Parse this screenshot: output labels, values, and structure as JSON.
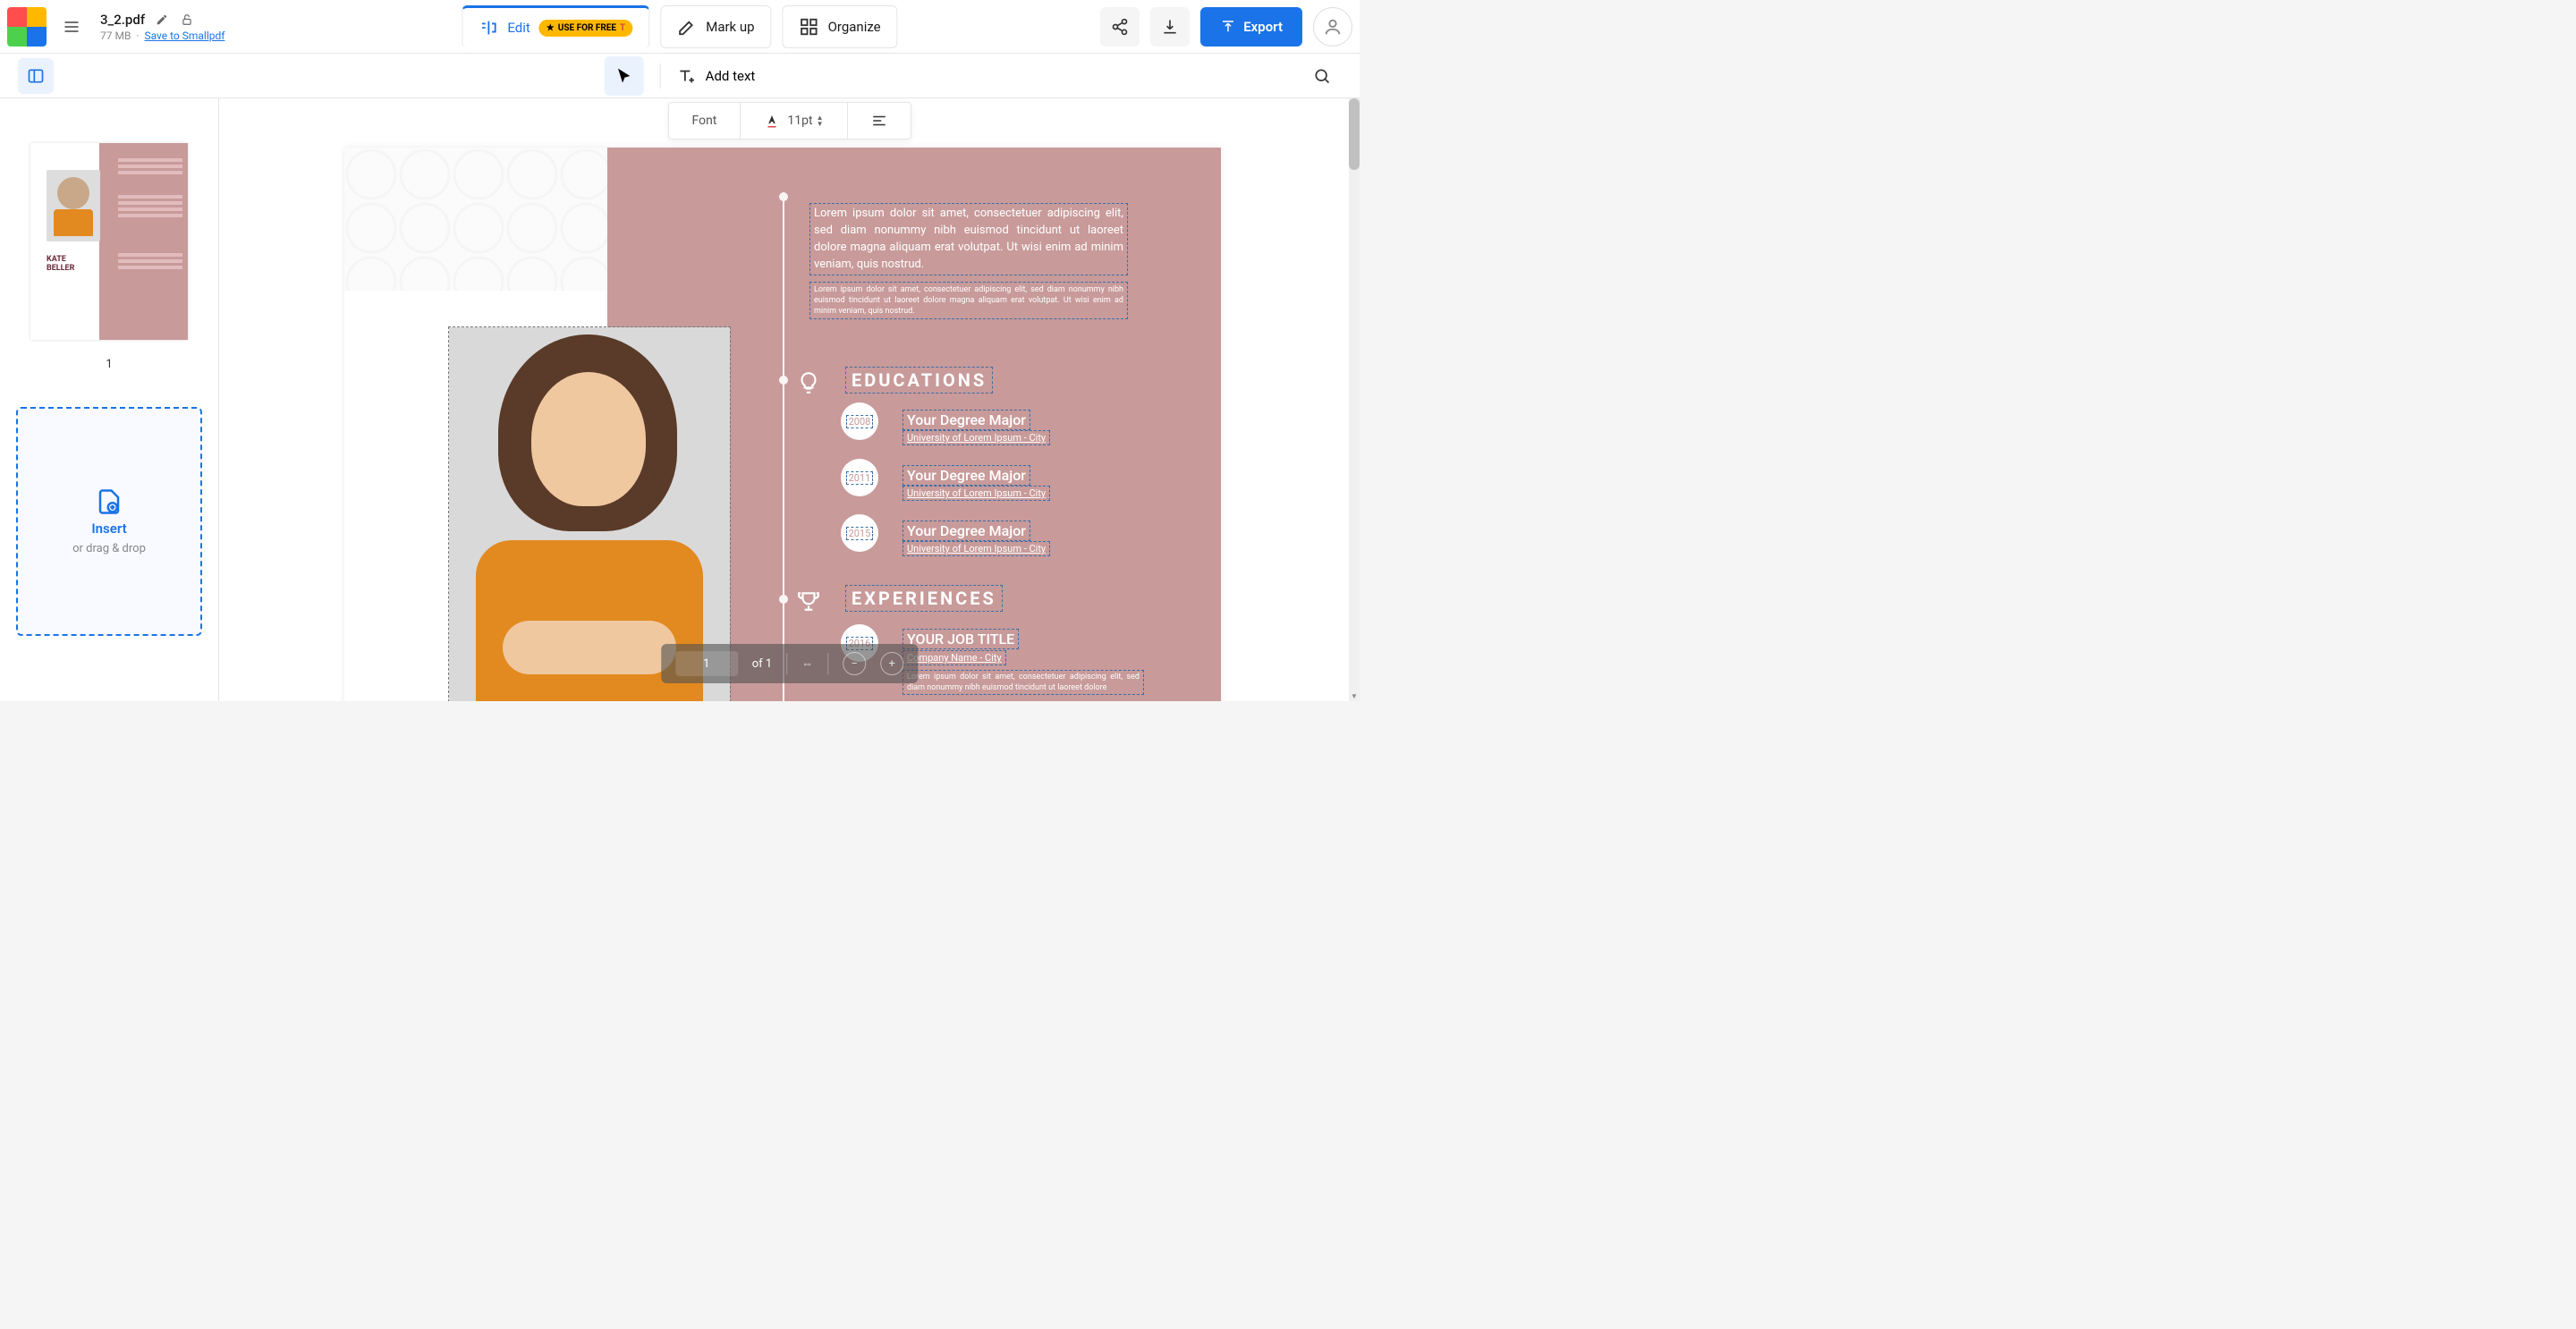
{
  "header": {
    "file_name": "3_2.pdf",
    "file_size": "77 MB",
    "save_link": "Save to Smallpdf"
  },
  "tabs": {
    "edit": "Edit",
    "badge": "USE FOR FREE",
    "markup": "Mark up",
    "organize": "Organize"
  },
  "actions": {
    "export": "Export"
  },
  "toolbar2": {
    "add_text": "Add text"
  },
  "floating": {
    "font_label": "Font",
    "font_size": "11pt"
  },
  "sidebar": {
    "thumb_name": "KATE\nBELLER",
    "page_num": "1",
    "insert_label": "Insert",
    "insert_sub": "or drag & drop"
  },
  "doc": {
    "intro1": "Lorem ipsum dolor sit amet, consectetuer adipiscing elit, sed diam nonummy nibh euismod tincidunt ut laoreet dolore magna aliquam erat volutpat. Ut wisi enim ad minim veniam, quis nostrud.",
    "intro2": "Lorem ipsum dolor sit amet, consectetuer adipiscing elit, sed diam nonummy nibh euismod tincidunt ut laoreet dolore magna aliquam erat volutpat. Ut wisi enim ad minim veniam, quis nostrud.",
    "sec_edu": "EDUCATIONS",
    "sec_exp": "EXPERIENCES",
    "edu": [
      {
        "year": "2008",
        "title": "Your Degree Major",
        "sub": "University of Lorem Ipsum - City"
      },
      {
        "year": "2011",
        "title": "Your Degree Major",
        "sub": "University of Lorem Ipsum - City"
      },
      {
        "year": "2015",
        "title": "Your Degree Major",
        "sub": "University of Lorem Ipsum - City"
      }
    ],
    "job": {
      "year": "2016",
      "title": "YOUR JOB TITLE",
      "sub": "Company Name - City",
      "body": "Lorem ipsum dolor sit amet, consectetuer adipiscing elit, sed diam nonummy nibh euismod tincidunt ut laoreet dolore"
    }
  },
  "bottom": {
    "page_current": "1",
    "page_total": "of 1"
  }
}
